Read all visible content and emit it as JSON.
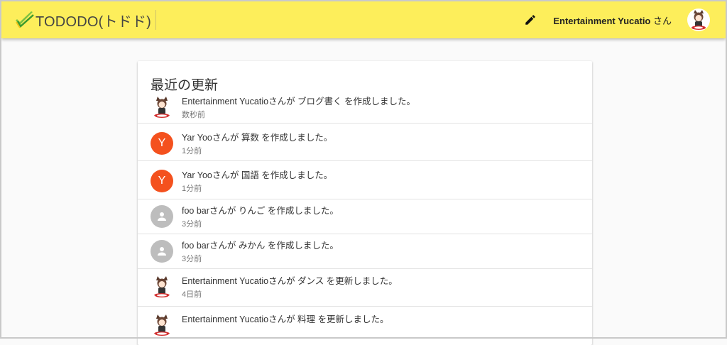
{
  "header": {
    "app_title": "TODODO(トドド)",
    "user_name": "Entertainment Yucatio",
    "user_suffix": " さん",
    "edit_icon": "pencil-icon",
    "brand_color": "#fdee5b"
  },
  "main": {
    "title": "最近の更新",
    "items": [
      {
        "avatar": "character-image",
        "text": "Entertainment Yucatioさんが ブログ書く を作成しました。",
        "time": "数秒前"
      },
      {
        "avatar": "letter",
        "letter": "Y",
        "text": "Yar Yooさんが 算数 を作成しました。",
        "time": "1分前"
      },
      {
        "avatar": "letter",
        "letter": "Y",
        "text": "Yar Yooさんが 国語 を作成しました。",
        "time": "1分前"
      },
      {
        "avatar": "person-icon",
        "text": "foo barさんが りんご を作成しました。",
        "time": "3分前"
      },
      {
        "avatar": "person-icon",
        "text": "foo barさんが みかん を作成しました。",
        "time": "3分前"
      },
      {
        "avatar": "character-image",
        "text": "Entertainment Yucatioさんが ダンス を更新しました。",
        "time": "4日前"
      },
      {
        "avatar": "character-image",
        "text": "Entertainment Yucatioさんが 料理 を更新しました。",
        "time": ""
      }
    ]
  }
}
